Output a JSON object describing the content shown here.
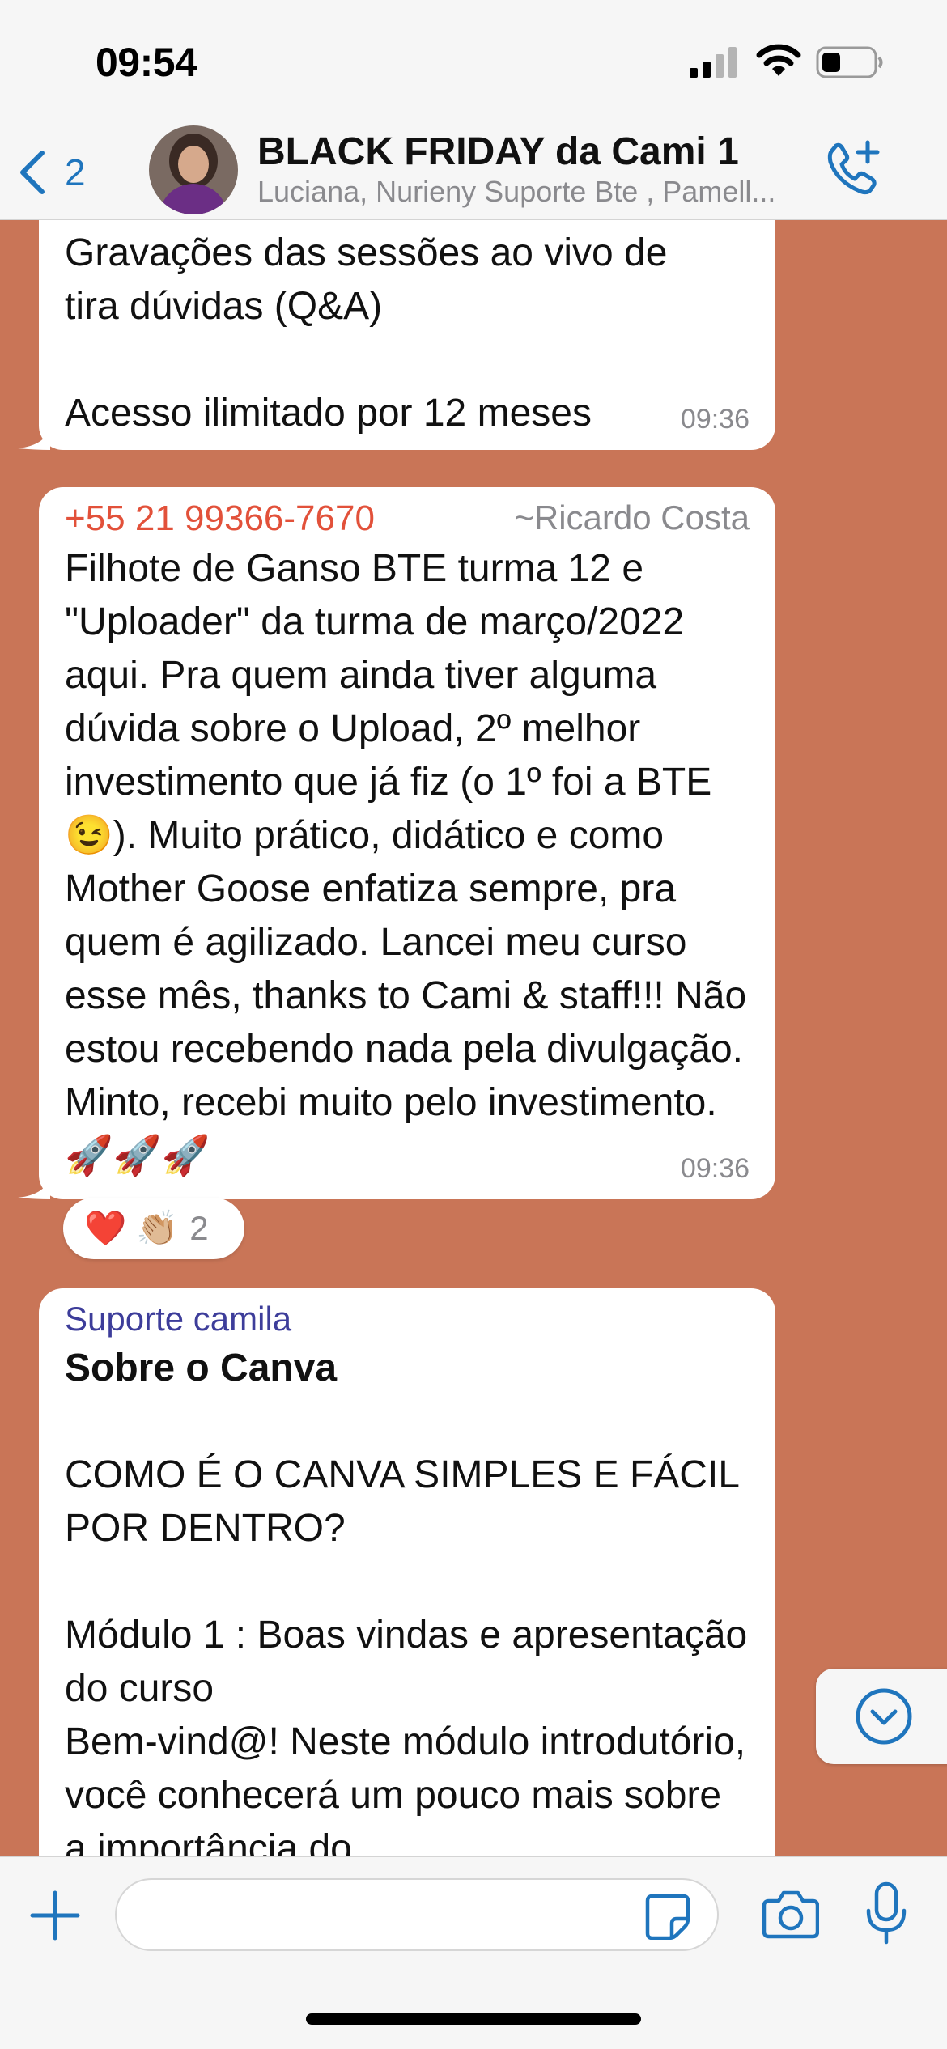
{
  "status_bar": {
    "time": "09:54",
    "icons": [
      "cellular-signal-icon",
      "wifi-icon",
      "battery-icon"
    ],
    "battery_level": 0.35
  },
  "header": {
    "back_count": "2",
    "title": "BLACK FRIDAY da Cami 1",
    "subtitle": "Luciana, Nurieny Suporte Bte , Pamell...",
    "icons": [
      "back-chevron-icon",
      "add-call-icon"
    ]
  },
  "messages": [
    {
      "text": "Gravações das sessões ao vivo de\ntira dúvidas (Q&A)\n\nAcesso ilimitado por 12 meses",
      "time": "09:36"
    },
    {
      "sender_phone": "+55 21 99366-7670",
      "sender_name": "~Ricardo Costa",
      "text": "Filhote de Ganso BTE turma 12 e \"Uploader\" da turma de março/2022 aqui. Pra quem ainda tiver alguma dúvida sobre o Upload, 2º melhor investimento que já fiz (o 1º foi a BTE 😉). Muito prático,  didático e como Mother Goose enfatiza sempre, pra quem é agilizado. Lancei meu curso esse mês, thanks to Cami & staff!!! Não estou recebendo nada pela divulgação. Minto, recebi muito pelo investimento. 🚀🚀🚀",
      "time": "09:36",
      "reactions": {
        "emojis": "❤️ 👏🏼",
        "count": "2"
      }
    },
    {
      "sender": "Suporte camila",
      "heading": "Sobre o Canva",
      "text": "COMO É O CANVA SIMPLES E FÁCIL POR DENTRO?\n\nMódulo 1 : Boas vindas e apresentação do curso\nBem-vind@! Neste módulo introdutório, você conhecerá um pouco mais sobre a importância do"
    }
  ],
  "input_bar": {
    "placeholder": "",
    "icons": [
      "plus-icon",
      "sticker-icon",
      "camera-icon",
      "microphone-icon"
    ]
  },
  "colors": {
    "chat_background": "#c97557",
    "accent_blue": "#1f75bd",
    "sender_phone_color": "#e2513a",
    "sender_support_color": "#3d3d9a"
  }
}
